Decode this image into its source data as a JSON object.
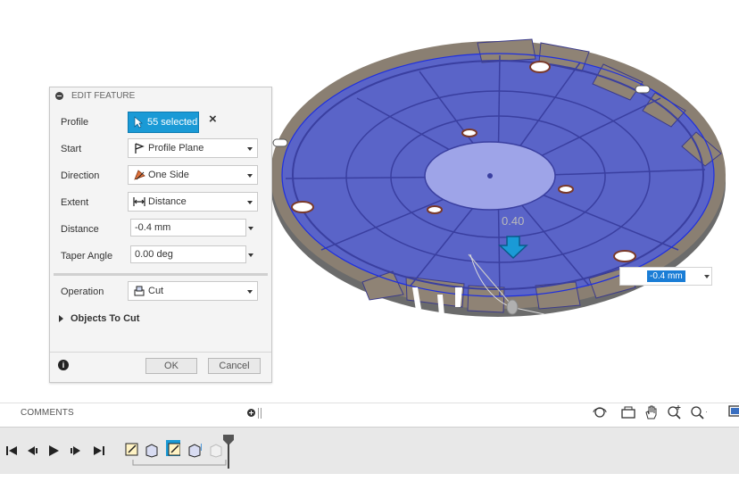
{
  "panel": {
    "title": "EDIT FEATURE",
    "profile": {
      "label": "Profile",
      "value": "55 selected"
    },
    "start": {
      "label": "Start",
      "value": "Profile Plane"
    },
    "direction": {
      "label": "Direction",
      "value": "One Side"
    },
    "extent": {
      "label": "Extent",
      "value": "Distance"
    },
    "distance": {
      "label": "Distance",
      "value": "-0.4 mm"
    },
    "taper": {
      "label": "Taper Angle",
      "value": "0.00 deg"
    },
    "operation": {
      "label": "Operation",
      "value": "Cut"
    },
    "objects_to_cut": "Objects To Cut",
    "ok_label": "OK",
    "cancel_label": "Cancel"
  },
  "viewport": {
    "dimension_value": "-0.4 mm",
    "dimension_ghost": "0.40"
  },
  "comments": {
    "label": "COMMENTS"
  },
  "colors": {
    "selected_face": "#5a64c8",
    "selection_blue": "#1a9ad6",
    "annotation_blue": "#1d2bd4",
    "annotation_red": "#e01a1a"
  },
  "icons": {
    "timeline_playback": [
      "skip-start-icon",
      "step-back-icon",
      "play-icon",
      "step-forward-icon",
      "skip-end-icon"
    ],
    "navigation": [
      "orbit-icon",
      "look-at-icon",
      "pan-icon",
      "zoom-window-icon",
      "zoom-icon",
      "display-settings-icon"
    ]
  }
}
